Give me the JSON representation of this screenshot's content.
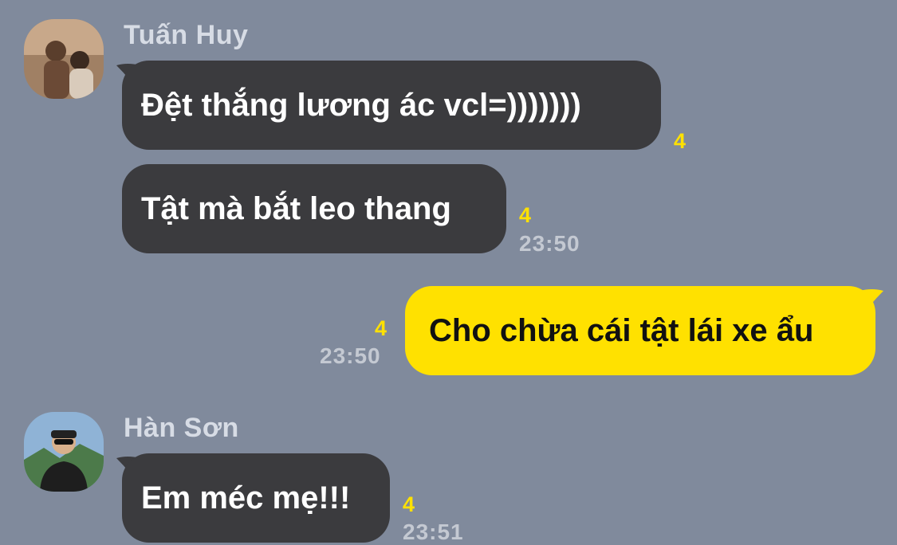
{
  "colors": {
    "background": "#808a9c",
    "incoming_bubble": "#3b3b3e",
    "outgoing_bubble": "#ffe100",
    "unread_count": "#ffe100",
    "sender_name": "#d7dce5",
    "timestamp": "#c4c9d2"
  },
  "messages": [
    {
      "sender": "Tuấn Huy",
      "avatar_icon": "user-avatar-photo",
      "text": "Đệt thắng lương ác vcl=)))))))",
      "unread": "4",
      "direction": "incoming"
    },
    {
      "sender": "Tuấn Huy",
      "text": "Tật mà bắt leo thang",
      "unread": "4",
      "time": "23:50",
      "direction": "incoming"
    },
    {
      "text": "Cho chừa cái tật lái xe ẩu",
      "unread": "4",
      "time": "23:50",
      "direction": "outgoing"
    },
    {
      "sender": "Hàn Sơn",
      "avatar_icon": "user-avatar-photo",
      "text": "Em méc mẹ!!!",
      "unread": "4",
      "time": "23:51",
      "direction": "incoming"
    }
  ]
}
